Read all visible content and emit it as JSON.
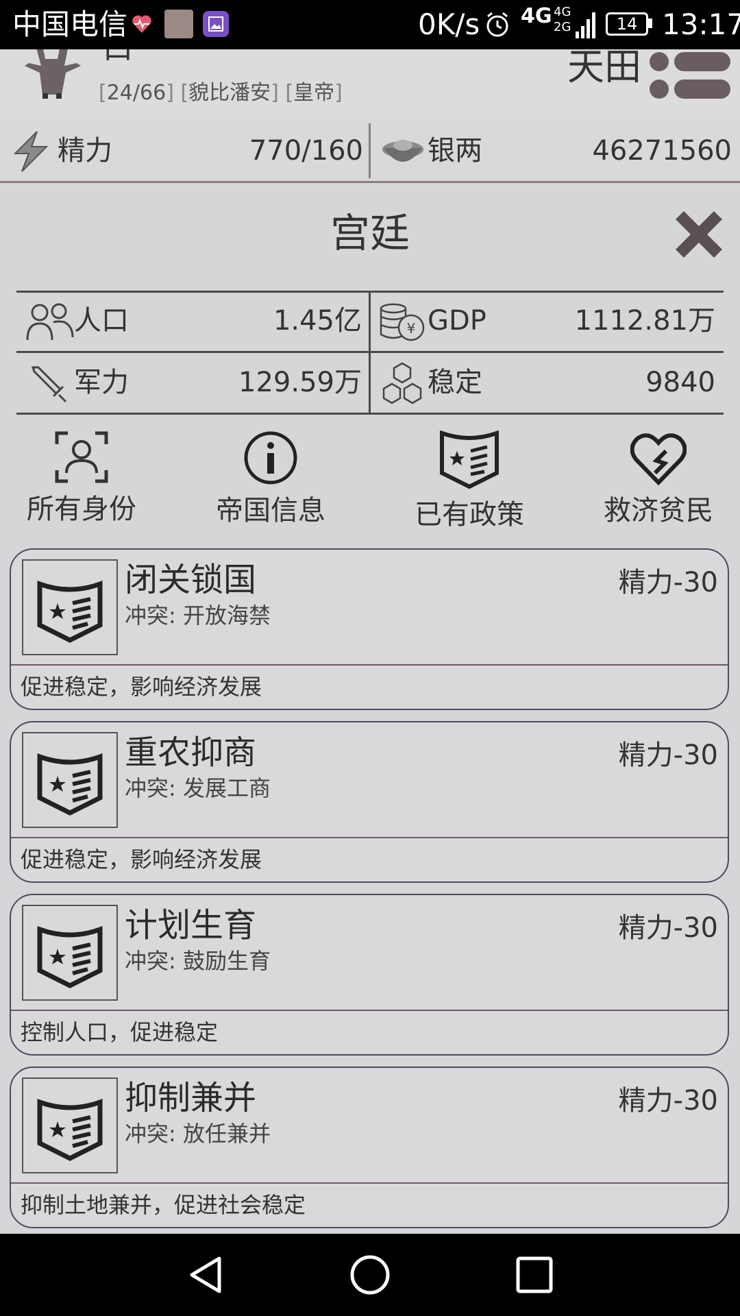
{
  "status_bar": {
    "carrier": "中国电信",
    "speed": "0K/s",
    "network": "4G",
    "network2": "4G",
    "network3": "2G",
    "battery": "14",
    "time": "13:17"
  },
  "header": {
    "tags": [
      "24/66",
      "貌比潘安",
      "皇帝"
    ],
    "right_text": "天田"
  },
  "resources": {
    "energy_label": "精力",
    "energy_value": "770/160",
    "silver_label": "银两",
    "silver_value": "46271560"
  },
  "court": {
    "title": "宫廷",
    "stats": {
      "population_label": "人口",
      "population_value": "1.45亿",
      "gdp_label": "GDP",
      "gdp_value": "1112.81万",
      "military_label": "军力",
      "military_value": "129.59万",
      "stability_label": "稳定",
      "stability_value": "9840"
    },
    "actions": [
      {
        "label": "所有身份",
        "icon": "identity-icon"
      },
      {
        "label": "帝国信息",
        "icon": "info-icon"
      },
      {
        "label": "已有政策",
        "icon": "policy-icon"
      },
      {
        "label": "救济贫民",
        "icon": "relief-heart-icon"
      }
    ]
  },
  "policies": [
    {
      "title": "闭关锁国",
      "conflict": "冲突: 开放海禁",
      "cost": "精力-30",
      "desc": "促进稳定，影响经济发展"
    },
    {
      "title": "重农抑商",
      "conflict": "冲突: 发展工商",
      "cost": "精力-30",
      "desc": "促进稳定，影响经济发展"
    },
    {
      "title": "计划生育",
      "conflict": "冲突: 鼓励生育",
      "cost": "精力-30",
      "desc": "控制人口，促进稳定"
    },
    {
      "title": "抑制兼并",
      "conflict": "冲突: 放任兼并",
      "cost": "精力-30",
      "desc": "抑制土地兼并，促进社会稳定"
    }
  ],
  "colors": {
    "background": "#d6d6d8",
    "line": "#4a4a4a",
    "card_border": "#4a4a60"
  }
}
